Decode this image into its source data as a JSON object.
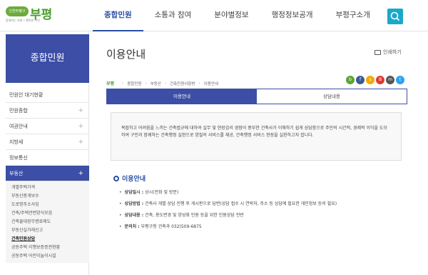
{
  "header": {
    "logo_badge": "인천부평구",
    "logo_text": "부평",
    "logo_sub": "함께하는 미래 • 행복한 구민",
    "nav": [
      "종합민원",
      "소통과 참여",
      "분야별정보",
      "행정정보공개",
      "부평구소개"
    ],
    "search_icon": "search-icon"
  },
  "sidebar": {
    "banner": "종합민원",
    "items": [
      {
        "label": "민원인 대기현황",
        "plus": ""
      },
      {
        "label": "민원종합",
        "plus": "+"
      },
      {
        "label": "여권안내",
        "plus": "+"
      },
      {
        "label": "지방세",
        "plus": "+"
      },
      {
        "label": "정보통신",
        "plus": ""
      },
      {
        "label": "부동산",
        "plus": "+"
      }
    ],
    "sub_items": [
      "개별주택가격",
      "부동산중개보수",
      "도로명주소사업",
      "건축/주택관련양식모음",
      "건축물대장무병료제도",
      "부동산실거래신고",
      "건축민원상담",
      "공동주택 이행보증증권현황",
      "공동주택 어린이놀이시설"
    ]
  },
  "main": {
    "title": "이용안내",
    "print_label": "인쇄하기",
    "breadcrumb": [
      "부평",
      "종합민원",
      "부동산",
      "건축민원사항방",
      "이용안내"
    ],
    "share": [
      {
        "icon": "blog-icon",
        "color": "#5ba532",
        "glyph": "b"
      },
      {
        "icon": "facebook-icon",
        "color": "#3b5998",
        "glyph": "f"
      },
      {
        "icon": "kakaostory-icon",
        "color": "#f2a900",
        "glyph": "s"
      },
      {
        "icon": "band-icon",
        "color": "#e03a2f",
        "glyph": "B"
      },
      {
        "icon": "message-icon",
        "color": "#555555",
        "glyph": "m"
      },
      {
        "icon": "twitter-icon",
        "color": "#2aa3ef",
        "glyph": "t"
      }
    ],
    "tabs": [
      "이용안내",
      "상담내용"
    ],
    "notice": "복잡하고 어려움을 느끼는 건축법규에 대하여 실무 및 현장감리 경험이 풍부한 건축사가 이해하기 쉽게 상담함으로 주민의 시간적, 경제적 이익을 도모하여 구민과 함께하는 건축행정 실현으로 양질의 서비스를 제공, 건축행정 서비스 현장을 실현하고자 합니다.",
    "section_title": "이용안내",
    "info": [
      {
        "label": "상담일시 :",
        "text": "상시(전화 및 방문)"
      },
      {
        "label": "상담방법 :",
        "text": "건축사 개별 상담 진행 후 게시판으로 답변(상담 접수 시 연락처, 주소 등 상담에 필요한 개인정보 등의 필요)"
      },
      {
        "label": "상담내용 :",
        "text": "건축, 용도변경 및 양성화 민원 등을 위한 민원상담 전반"
      },
      {
        "label": "문의처 :",
        "text": "부평구청 건축과 032)509-6875"
      }
    ]
  }
}
